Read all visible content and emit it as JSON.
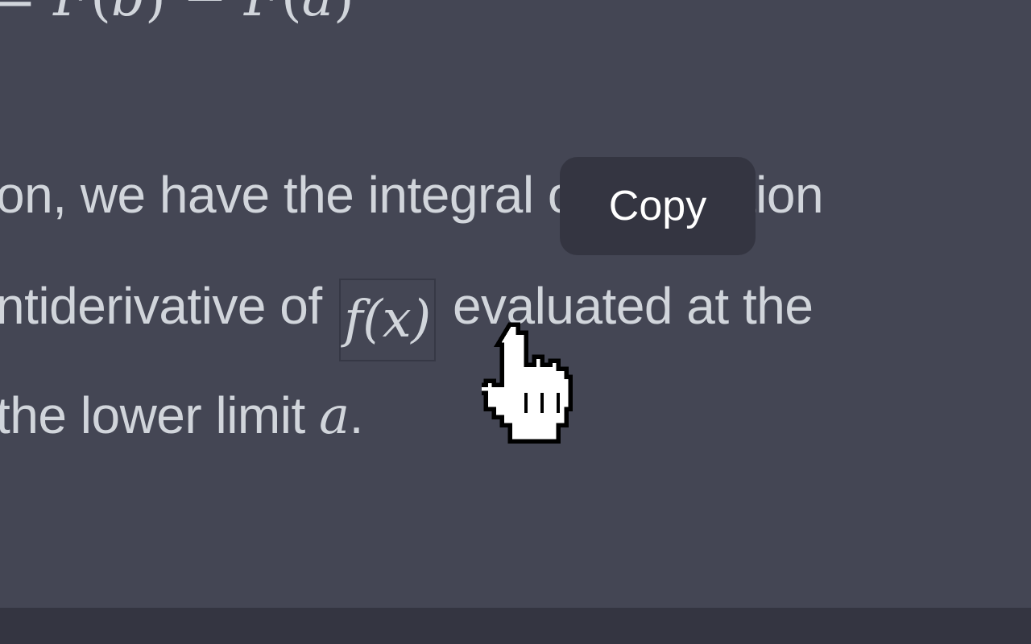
{
  "equation_top": {
    "equals": "=",
    "F1": "F",
    "open1": "(",
    "b": "b",
    "close1": ")",
    "minus": "−",
    "F2": "F",
    "open2": "(",
    "a": "a",
    "close2": ")"
  },
  "paragraph": {
    "line1": "on, we have the integral of a function",
    "line2_before": "ntiderivative of ",
    "line2_math": "f(x)",
    "line2_after": " evaluated at the",
    "line3_before": "the lower limit ",
    "line3_math": "a",
    "line3_after": "."
  },
  "tooltip": {
    "label": "Copy"
  },
  "cursor": {
    "icon": "hand-pointer-icon"
  },
  "colors": {
    "background": "#444654",
    "text": "#d1d5db",
    "tooltip_bg": "#343541",
    "tooltip_text": "#ffffff",
    "footer": "#343541"
  }
}
